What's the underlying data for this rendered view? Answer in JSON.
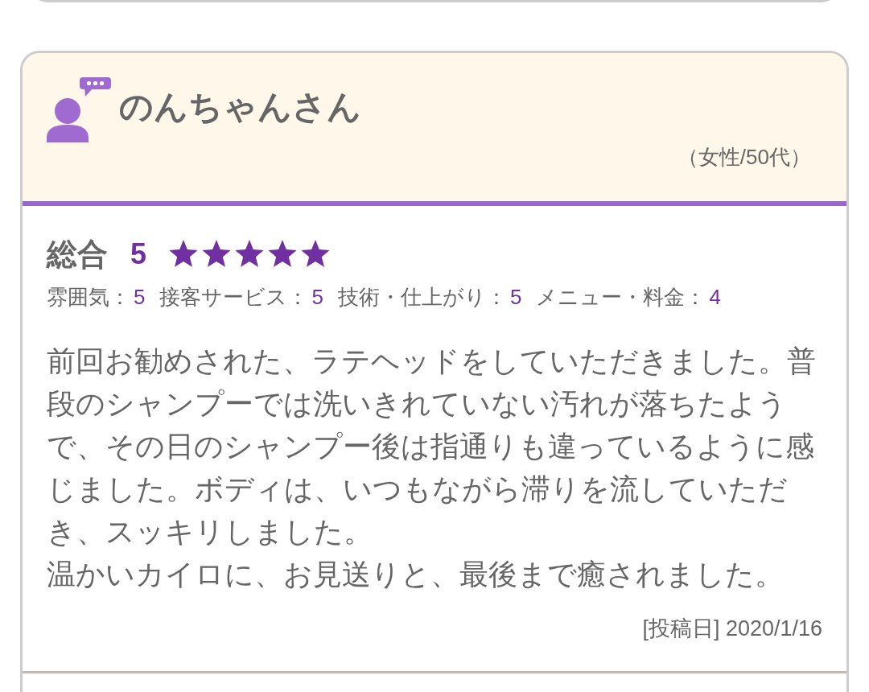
{
  "review": {
    "reviewer": {
      "name": "のんちゃんさん",
      "profile": "（女性/50代）"
    },
    "overall": {
      "label": "総合",
      "score": "5",
      "stars": 5
    },
    "ratings": [
      {
        "label": "雰囲気：",
        "value": "5"
      },
      {
        "label": "接客サービス：",
        "value": "5"
      },
      {
        "label": "技術・仕上がり：",
        "value": "5"
      },
      {
        "label": "メニュー・料金：",
        "value": "4"
      }
    ],
    "comment": [
      "前回お勧めされた、ラテヘッドをしていただきました。普段のシャンプーでは洗いきれていない汚れが落ちたようで、その日のシャンプー後は指通りも違っているように感じました。ボディは、いつもながら滞りを流していただき、スッキリしました。",
      "温かいカイロに、お見送りと、最後まで癒されました。"
    ],
    "posted": "[投稿日] 2020/1/16"
  }
}
